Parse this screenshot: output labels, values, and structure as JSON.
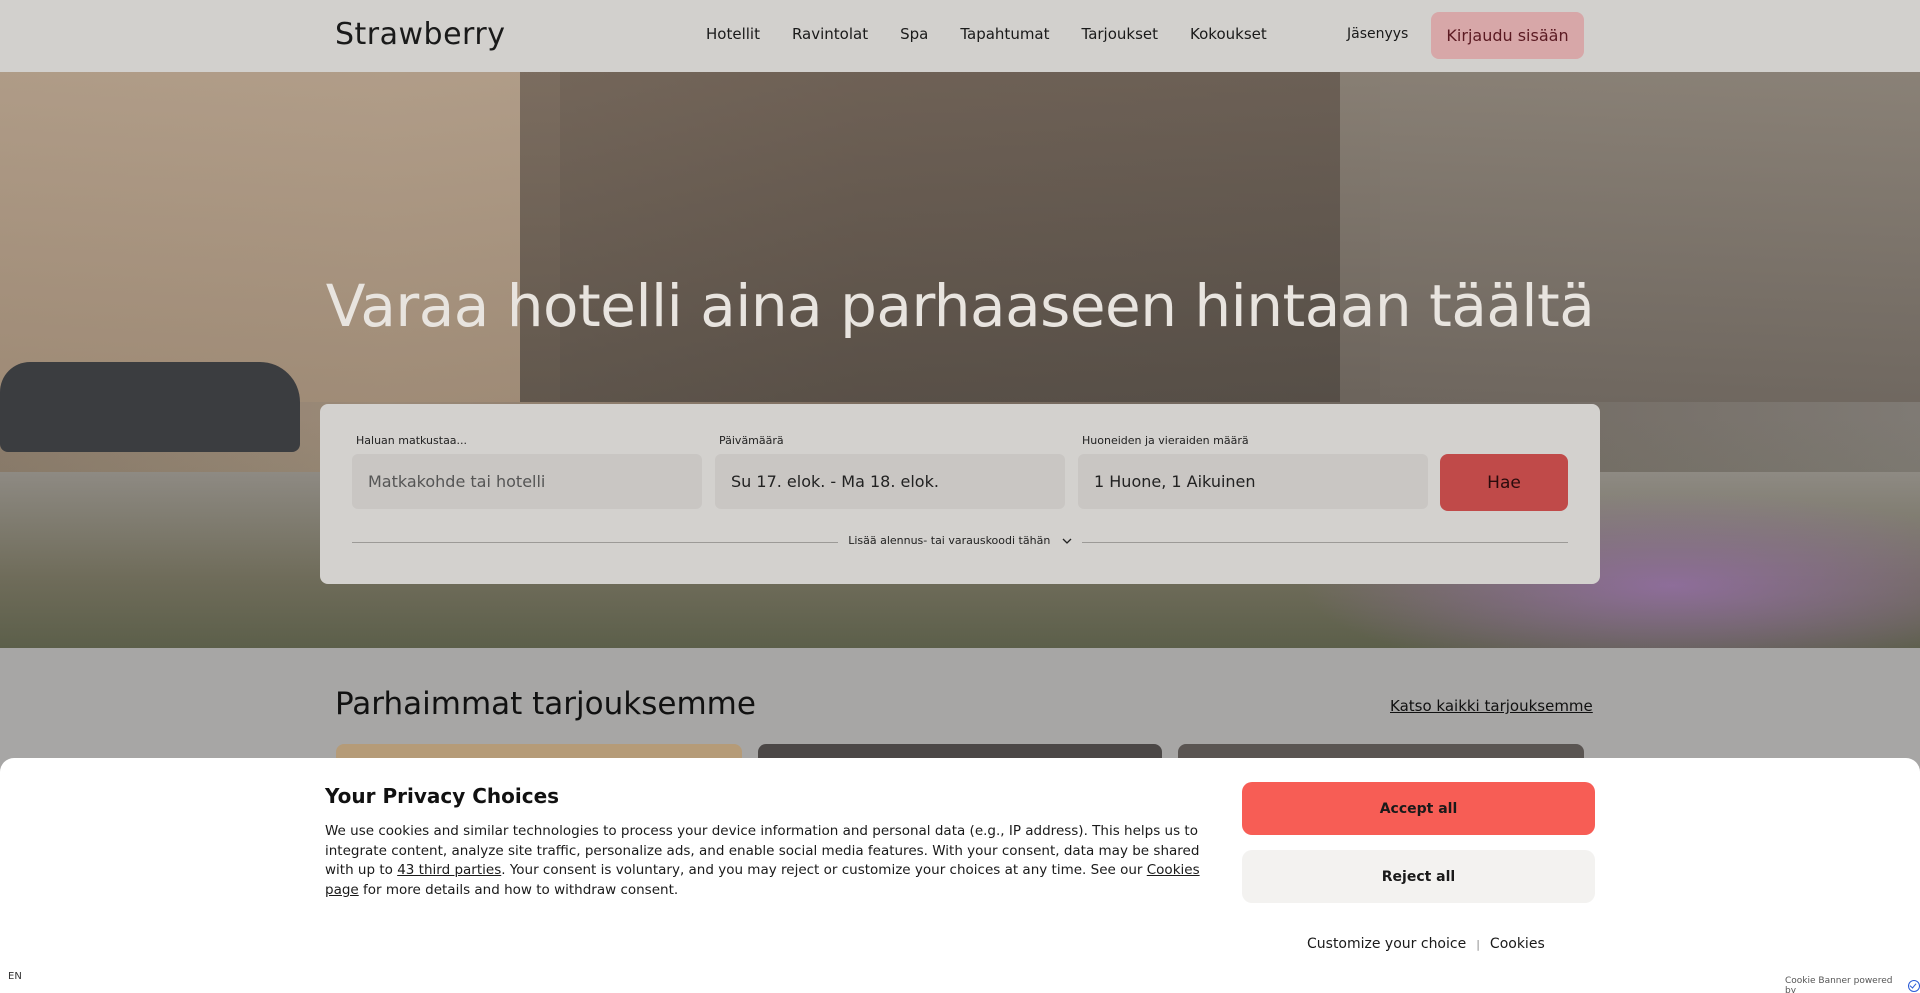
{
  "header": {
    "logo": "Strawberry",
    "nav": [
      "Hotellit",
      "Ravintolat",
      "Spa",
      "Tapahtumat",
      "Tarjoukset",
      "Kokoukset"
    ],
    "membership": "Jäsenyys",
    "login": "Kirjaudu sisään"
  },
  "hero": {
    "title": "Varaa hotelli aina parhaaseen hintaan täältä"
  },
  "search": {
    "destination_label": "Haluan matkustaa...",
    "destination_placeholder": "Matkakohde tai hotelli",
    "date_label": "Päivämäärä",
    "date_value": "Su 17. elok. - Ma 18. elok.",
    "guests_label": "Huoneiden ja vieraiden määrä",
    "guests_value": "1 Huone, 1 Aikuinen",
    "submit": "Hae",
    "promo_code": "Lisää alennus- tai varauskoodi tähän"
  },
  "offers": {
    "title": "Parhaimmat tarjouksemme",
    "see_all": "Katso kaikki tarjouksemme"
  },
  "cookie_banner": {
    "title": "Your Privacy Choices",
    "text_1": "We use cookies and similar technologies to process your device information and personal data (e.g., IP address). This helps us to integrate content, analyze site traffic, personalize ads, and enable social media features. With your consent, data may be shared with up to ",
    "third_parties_link": "43 third parties",
    "text_2": ". Your consent is voluntary, and you may reject or customize your choices at any time. See our ",
    "cookies_page_link": "Cookies page",
    "text_3": " for more details and how to withdraw consent.",
    "accept": "Accept all",
    "reject": "Reject all",
    "customize": "Customize your choice",
    "separator": "|",
    "cookies": "Cookies",
    "language": "EN",
    "powered_by": "Cookie Banner powered by"
  },
  "colors": {
    "accept_bg": "#f75d55",
    "reject_bg": "#f3f2f0",
    "login_bg": "#d7a7a8",
    "search_button_bg": "#c04a49"
  }
}
